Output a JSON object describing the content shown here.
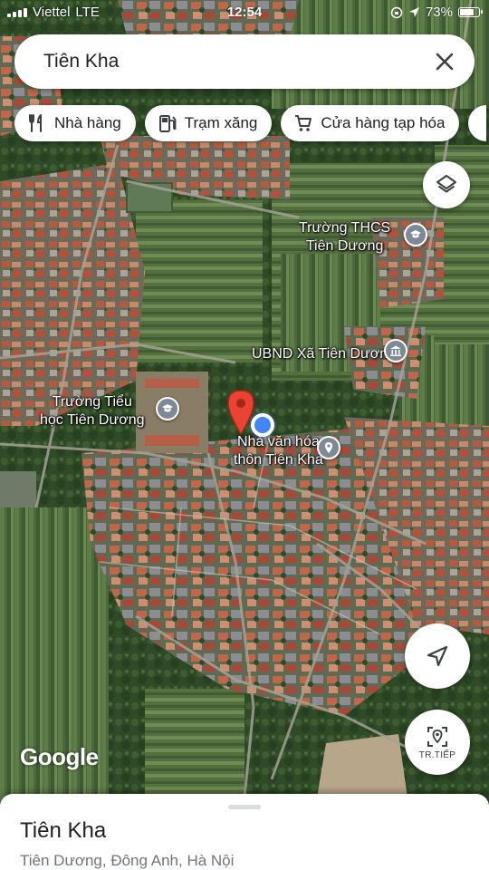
{
  "status_bar": {
    "carrier": "Viettel",
    "network": "LTE",
    "time": "12:54",
    "battery": "73%",
    "battery_level": 0.73,
    "signal_bars": 4
  },
  "search": {
    "query": "Tiên Kha",
    "close_icon": "close-icon"
  },
  "chips": [
    {
      "label": "Nhà hàng",
      "icon": "restaurant-icon"
    },
    {
      "label": "Trạm xăng",
      "icon": "gas-station-icon"
    },
    {
      "label": "Cửa hàng tạp hóa",
      "icon": "shopping-cart-icon"
    }
  ],
  "map": {
    "places": [
      {
        "line1": "Trường THCS",
        "line2": "Tiên Dương",
        "icon": "school-icon"
      },
      {
        "line1": "UBND Xã Tiên Dương",
        "line2": "",
        "icon": "government-icon"
      },
      {
        "line1": "Trường Tiểu",
        "line2": "học Tiên Dương",
        "icon": "school-icon"
      },
      {
        "line1": "Nhà văn hóa",
        "line2": "thôn Tiên Kha",
        "icon": "location-icon"
      }
    ],
    "attribution": "Google",
    "navigate_label": "TR.TIẾP",
    "colors": {
      "pin_red": "#ea4335",
      "my_location_blue": "#4285f4"
    }
  },
  "sheet": {
    "title": "Tiên Kha",
    "address": "Tiên Dương, Đông Anh, Hà Nội"
  }
}
